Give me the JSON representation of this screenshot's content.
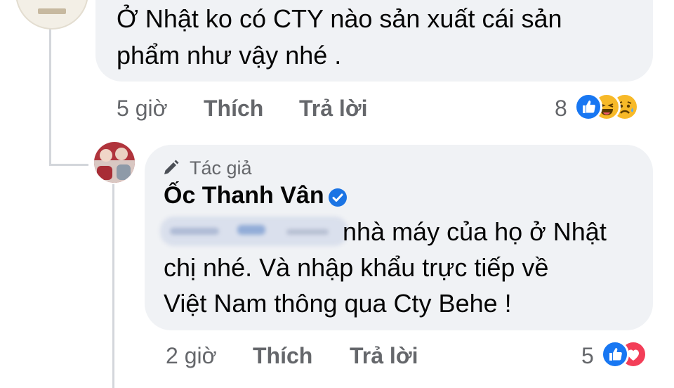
{
  "comment1": {
    "text_line1": "Ở Nhật ko có CTY nào sản xuất cái sản",
    "text_line2": "phẩm như vậy nhé .",
    "time": "5 giờ",
    "like_label": "Thích",
    "reply_label": "Trả lời",
    "reaction_count": "8",
    "reactions": [
      "like-icon",
      "haha-icon",
      "sad-icon"
    ]
  },
  "reply": {
    "badge_label": "Tác giả",
    "author_name": "Ốc Thanh Vân",
    "text_line1": "nhà máy của họ ở Nhật",
    "text_line2": "chị nhé. Và nhập khẩu trực tiếp về",
    "text_line3": "Việt Nam thông qua Cty Behe !",
    "time": "2 giờ",
    "like_label": "Thích",
    "reply_label": "Trả lời",
    "reaction_count": "5",
    "reactions": [
      "like-icon",
      "love-icon"
    ]
  },
  "colors": {
    "bubble": "#f0f2f5",
    "meta": "#65676b",
    "like_blue": "#1877f2",
    "verified_blue": "#1b74e4"
  }
}
